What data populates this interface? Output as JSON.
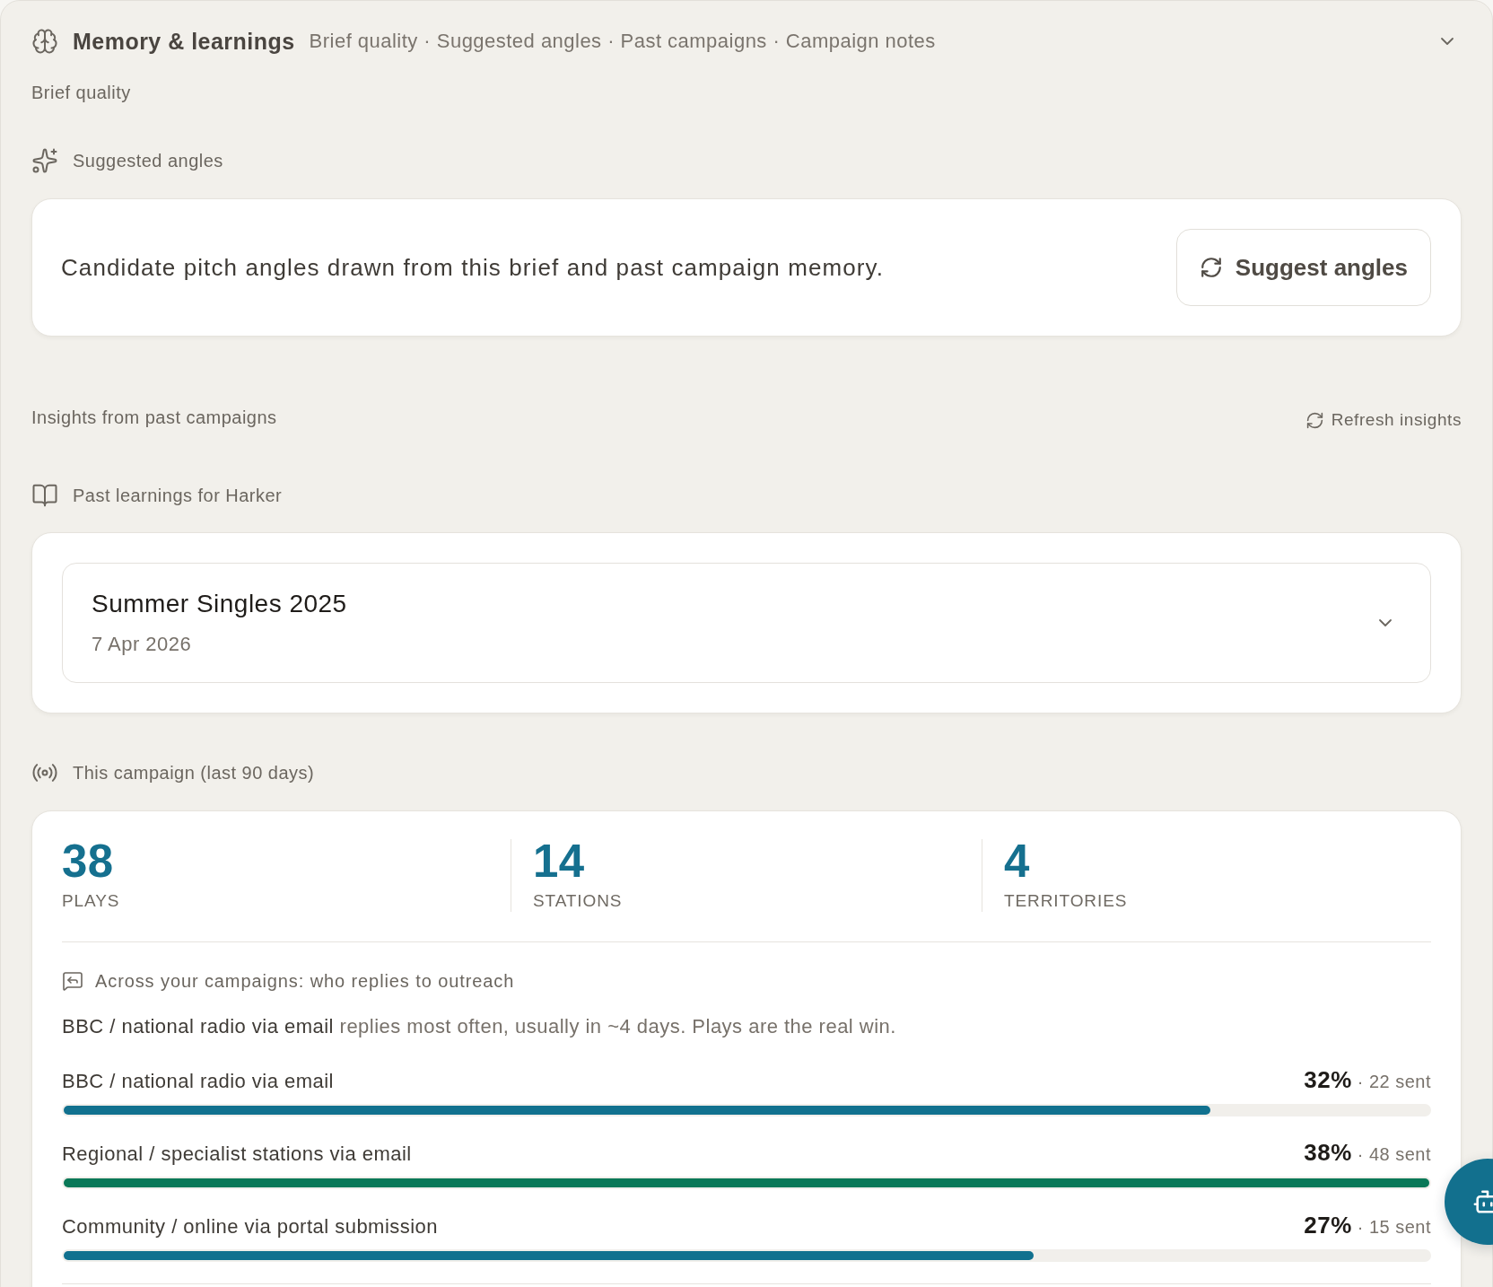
{
  "header": {
    "title": "Memory & learnings",
    "summary": "Brief quality · Suggested angles · Past campaigns · Campaign notes"
  },
  "brief_quality": {
    "label": "Brief quality"
  },
  "suggested_angles": {
    "label": "Suggested angles",
    "description": "Candidate pitch angles drawn from this brief and past campaign memory.",
    "button": "Suggest angles"
  },
  "insights": {
    "label": "Insights from past campaigns",
    "refresh": "Refresh insights"
  },
  "past_learnings": {
    "label": "Past learnings for Harker",
    "campaigns": [
      {
        "title": "Summer Singles 2025",
        "date": "7 Apr 2026",
        "expanded": false
      }
    ]
  },
  "this_campaign": {
    "label": "This campaign (last 90 days)",
    "stats": [
      {
        "value": "38",
        "label": "PLAYS"
      },
      {
        "value": "14",
        "label": "STATIONS"
      },
      {
        "value": "4",
        "label": "TERRITORIES"
      }
    ],
    "replies": {
      "heading": "Across your campaigns: who replies to outreach",
      "summary_lead": "BBC / national radio via email",
      "summary_rest": "replies most often, usually in ~4 days. Plays are the real win.",
      "channels": [
        {
          "name": "BBC / national radio via email",
          "rate": "32%",
          "sent": "· 22 sent",
          "level": 0.84,
          "color": "#11718f"
        },
        {
          "name": "Regional / specialist stations via email",
          "rate": "38%",
          "sent": "· 48 sent",
          "level": 1,
          "color": "#0a7857"
        },
        {
          "name": "Community / online via portal submission",
          "rate": "27%",
          "sent": "· 15 sent",
          "level": 0.71,
          "color": "#11718f"
        }
      ]
    }
  }
}
